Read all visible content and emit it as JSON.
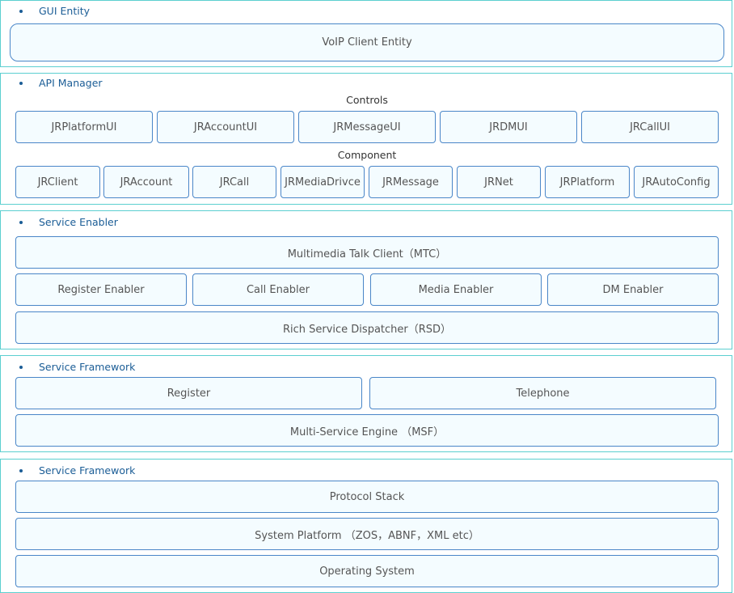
{
  "gui": {
    "title": "GUI Entity",
    "boxes": [
      "VoIP Client Entity"
    ]
  },
  "api": {
    "title": "API Manager",
    "controls_label": "Controls",
    "controls": [
      "JRPlatformUI",
      "JRAccountUI",
      "JRMessageUI",
      "JRDMUI",
      "JRCallUI"
    ],
    "component_label": "Component",
    "components": [
      "JRClient",
      "JRAccount",
      "JRCall",
      "JRMediaDrivce",
      "JRMessage",
      "JRNet",
      "JRPlatform",
      "JRAutoConfig"
    ]
  },
  "enabler": {
    "title": "Service Enabler",
    "boxes": [
      "Multimedia Talk Client（MTC）",
      "Register Enabler",
      "Call Enabler",
      "Media Enabler",
      "DM Enabler",
      "Rich Service Dispatcher（RSD）"
    ]
  },
  "framework": {
    "title": "Service Framework",
    "boxes": [
      "Register",
      "Telephone",
      "Multi-Service Engine （MSF）"
    ]
  },
  "framework2": {
    "title": "Service Framework",
    "boxes": [
      "Protocol Stack",
      "System Platform （ZOS，ABNF，XML etc）",
      "Operating System"
    ]
  },
  "colors": {
    "section_border": "#5ccfd0",
    "box_border": "#4a86c8",
    "box_fill": "#f4fcff",
    "title": "#1b5d96"
  }
}
